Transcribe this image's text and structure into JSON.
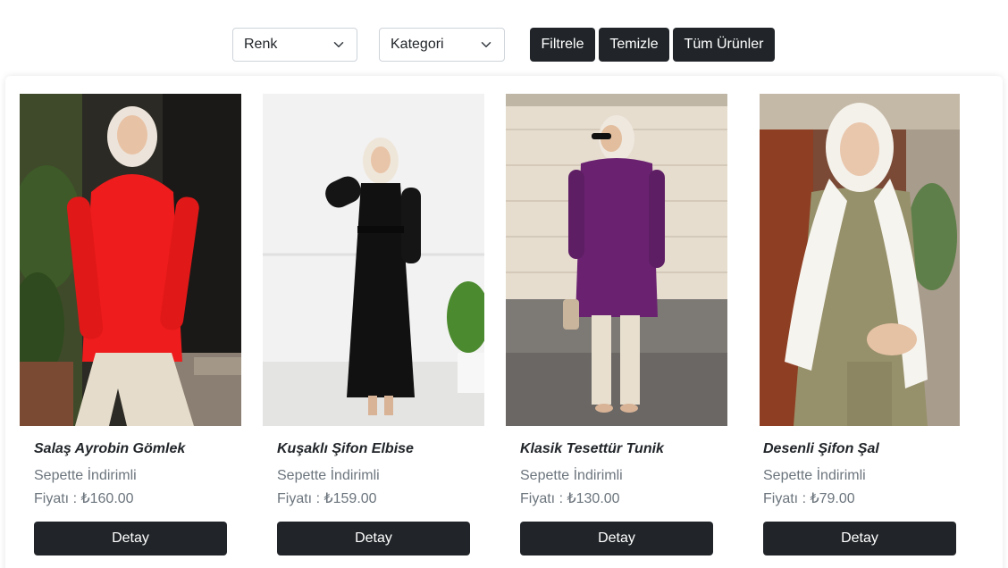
{
  "filters": {
    "color_select": "Renk",
    "category_select": "Kategori",
    "filter_button": "Filtrele",
    "clear_button": "Temizle",
    "all_products_button": "Tüm Ürünler"
  },
  "products": [
    {
      "title": "Salaş Ayrobin Gömlek",
      "discount_label": "Sepette İndirimli",
      "price": "Fiyatı : ₺160.00",
      "button": "Detay",
      "garment_color": "#ee1c1c",
      "image": "woman-in-red-shirt"
    },
    {
      "title": "Kuşaklı Şifon Elbise",
      "discount_label": "Sepette İndirimli",
      "price": "Fiyatı : ₺159.00",
      "button": "Detay",
      "garment_color": "#111111",
      "image": "woman-in-black-dress"
    },
    {
      "title": "Klasik Tesettür Tunik",
      "discount_label": "Sepette İndirimli",
      "price": "Fiyatı : ₺130.00",
      "button": "Detay",
      "garment_color": "#6a2270",
      "image": "woman-in-purple-tunic"
    },
    {
      "title": "Desenli Şifon Şal",
      "discount_label": "Sepette İndirimli",
      "price": "Fiyatı : ₺79.00",
      "button": "Detay",
      "garment_color": "#f4f1ea",
      "image": "woman-in-white-shawl"
    }
  ]
}
